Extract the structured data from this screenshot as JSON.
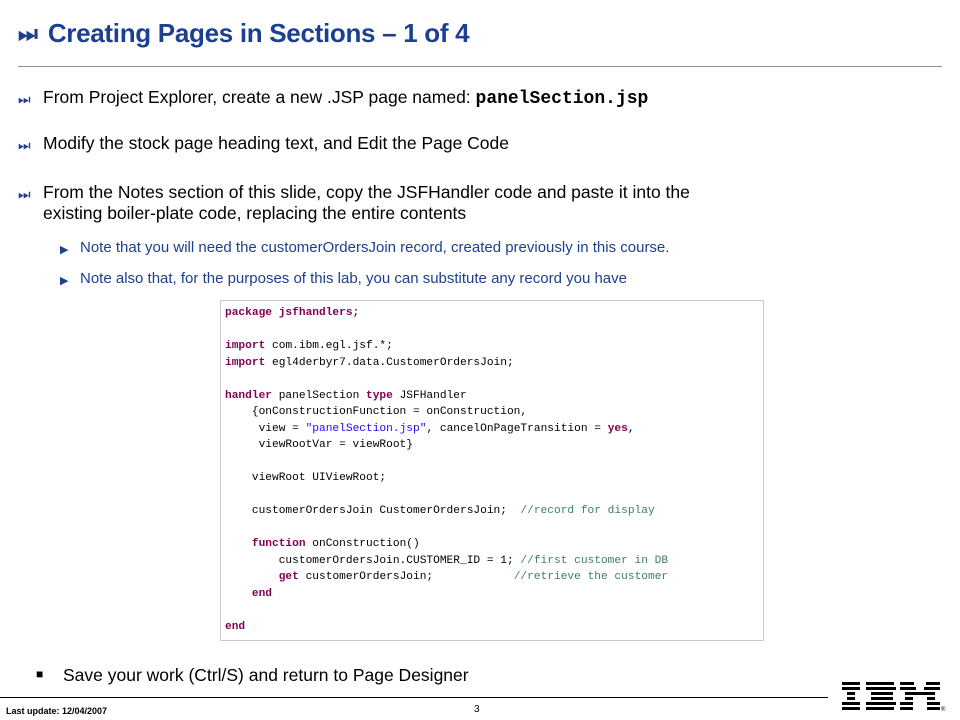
{
  "title": {
    "icon": "⏭",
    "text": "Creating Pages in Sections – 1 of 4"
  },
  "bullets": {
    "icon": "⏭",
    "b1_prefix": "From Project Explorer, create a new .JSP page named: ",
    "b1_filename": "panelSection.jsp",
    "b2": "Modify the stock page heading text, and Edit the Page Code",
    "b3_line1": "From the Notes section of this slide, copy the JSFHandler code and paste it into the",
    "b3_line2": "existing boiler-plate code, replacing the entire contents",
    "sub_icon": "▶",
    "sub1": "Note that you will need the customerOrdersJoin record, created previously in this course.",
    "sub2": "Note also that, for the purposes of this lab, you can substitute any record you have"
  },
  "code": {
    "l1": "package jsfhandlers;",
    "l3_kw": "import",
    "l3_rest": " com.ibm.egl.jsf.*;",
    "l4_kw": "import",
    "l4_rest": " egl4derbyr7.data.CustomerOrdersJoin;",
    "l6_kw1": "handler",
    "l6_mid": " panelSection ",
    "l6_kw2": "type",
    "l6_rest": " JSFHandler",
    "l7": "    {onConstructionFunction = onConstruction,",
    "l8_a": "     view = ",
    "l8_str": "\"panelSection.jsp\"",
    "l8_b": ", cancelOnPageTransition = ",
    "l8_kw": "yes",
    "l8_c": ",",
    "l9": "     viewRootVar = viewRoot}",
    "l11": "    viewRoot UIViewRoot;",
    "l13_a": "    customerOrdersJoin CustomerOrdersJoin;  ",
    "l13_cm": "//record for display",
    "l15_kw": "function",
    "l15_rest": " onConstruction()",
    "l16_a": "        customerOrdersJoin.CUSTOMER_ID = 1; ",
    "l16_cm": "//first customer in DB",
    "l17_kw": "get",
    "l17_a": " customerOrdersJoin;            ",
    "l17_cm": "//retrieve the customer",
    "l18_kw": "end",
    "l20_kw": "end"
  },
  "save": {
    "icon": "■",
    "text": "Save your work (Ctrl/S) and return to Page Designer"
  },
  "footer": {
    "last_update": "Last update: 12/04/2007",
    "page_number": "3",
    "logo_text": "IBM"
  },
  "colors": {
    "title": "#1c3f91",
    "sub_bullet": "#1c3f91",
    "keyword": "#7f0055",
    "string": "#2a00ff",
    "comment": "#3f7f5f"
  }
}
